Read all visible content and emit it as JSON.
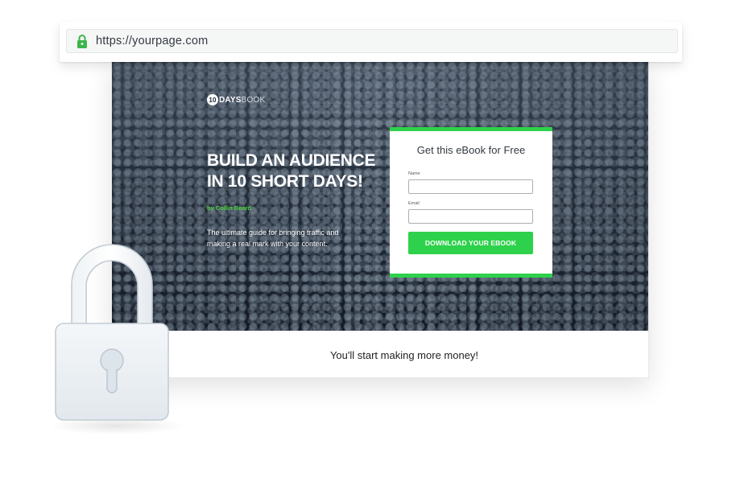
{
  "browser": {
    "url": "https://yourpage.com",
    "secure_icon": "lock-icon"
  },
  "hero": {
    "logo_number": "10",
    "logo_days": "DAYS",
    "logo_book": "BOOK",
    "headline_line1": "BUILD AN AUDIENCE",
    "headline_line2": "IN 10 SHORT DAYS!",
    "author": "by Collin Beard",
    "subtext": "The ultimate guide for bringing traffic and making a real mark with your content."
  },
  "form": {
    "title": "Get this eBook for Free",
    "name_label": "Name",
    "name_value": "",
    "email_label": "Email",
    "email_value": "",
    "submit_label": "DOWNLOAD YOUR EBOOK"
  },
  "footer": {
    "text": "You'll start making more money!"
  },
  "decor": {
    "padlock_icon": "padlock-icon"
  },
  "colors": {
    "accent_green": "#2ed14b",
    "author_green": "#4cd43a",
    "hero_dark": "#1b2330"
  }
}
